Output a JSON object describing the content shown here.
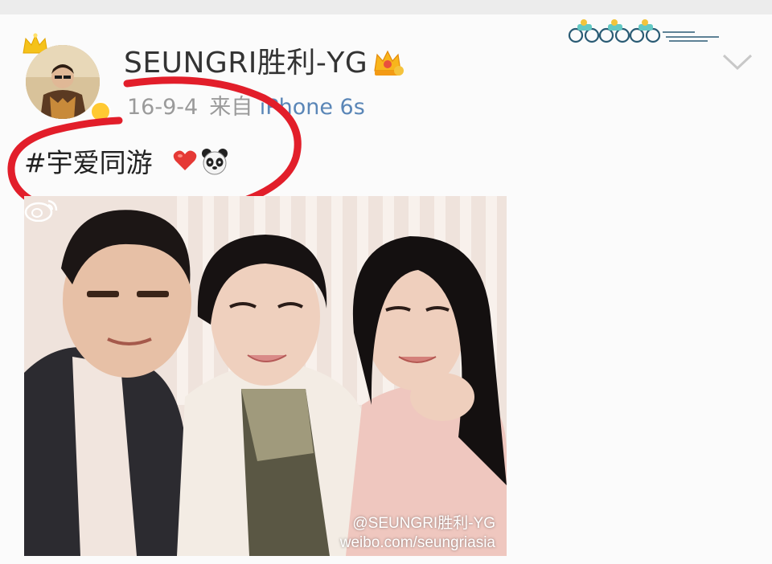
{
  "post": {
    "username": "SEUNGRI胜利-YG",
    "date": "16-9-4",
    "source_prefix": "来自",
    "device": "iPhone 6s",
    "text": "#宇爱同游"
  },
  "photo": {
    "watermark_handle": "@SEUNGRI胜利-YG",
    "watermark_url": "weibo.com/seungriasia"
  },
  "icons": {
    "crown": "crown-icon",
    "vip": "vip-badge-icon",
    "user_badge": "crown-badge-icon",
    "chevron": "chevron-down-icon",
    "heart": "heart-emoji",
    "panda": "panda-emoji",
    "weibo": "weibo-logo-icon",
    "decoration": "bicycle-decoration"
  },
  "colors": {
    "annotation": "#e21e2a",
    "device_link": "#5a86b7",
    "meta_text": "#9a9a9a"
  }
}
